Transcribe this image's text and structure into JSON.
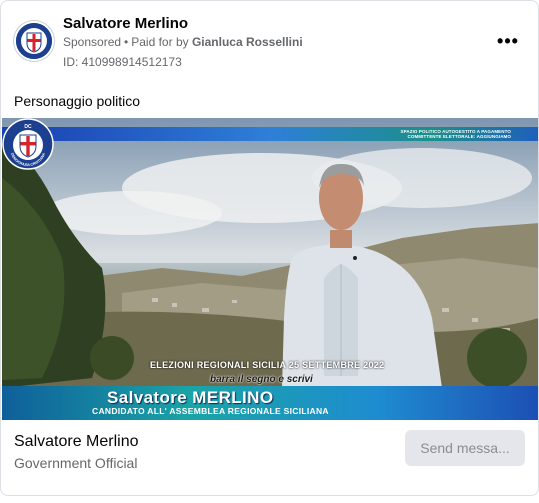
{
  "post": {
    "page_name": "Salvatore Merlino",
    "sponsored_label": "Sponsored",
    "paid_for_prefix": "Paid for by",
    "paid_for_name": "Gianluca Rossellini",
    "ad_id": "ID: 410998914512173",
    "body_text": "Personaggio politico"
  },
  "video": {
    "top_band_line1": "SPAZIO POLITICO AUTOGESTITO A PAGAMENTO",
    "top_band_line2": "COMMITTENTE ELETTORALE: AGGIUNGIAMO",
    "election_text": "ELEZIONI REGIONALI SICILIA 25 SETTEMBRE 2022",
    "barra_text": "barra il segno e scrivi",
    "lower_name": "Salvatore MERLINO",
    "lower_sub": "CANDIDATO ALL' ASSEMBLEA REGIONALE SICILIANA",
    "badge_top": "DC",
    "badge_ring": "DEMOCRAZIA CRISTIANA"
  },
  "cta": {
    "title": "Salvatore Merlino",
    "subtitle": "Government Official",
    "button_label": "Send messa..."
  },
  "icons": {
    "more": "more-options-icon",
    "logo": "democrazia-cristiana-shield-icon"
  },
  "colors": {
    "text_primary": "#050505",
    "text_secondary": "#65676b",
    "button_bg": "#e4e6eb",
    "button_text": "#8a8d91",
    "dc_blue": "#1c3f8f"
  }
}
